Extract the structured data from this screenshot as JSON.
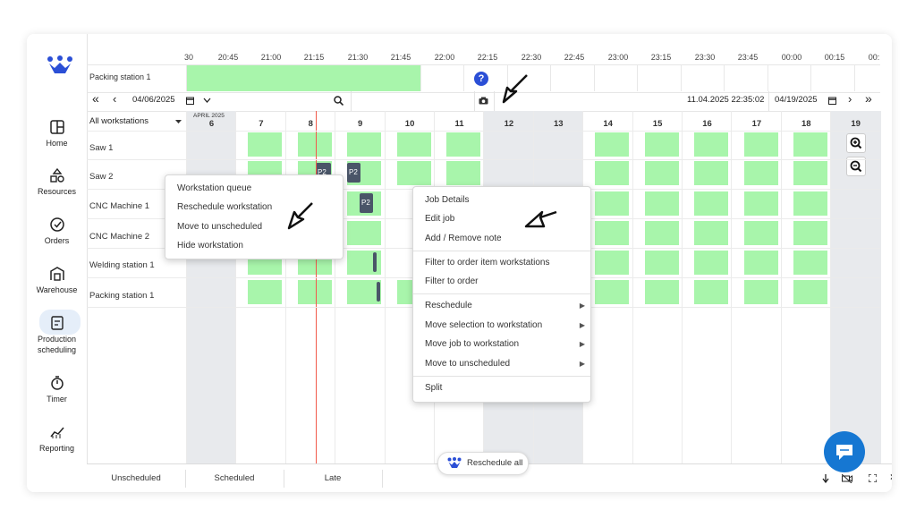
{
  "sidebar": {
    "items": [
      {
        "label": "Home",
        "icon": "home-icon"
      },
      {
        "label": "Resources",
        "icon": "resources-icon"
      },
      {
        "label": "Orders",
        "icon": "orders-icon"
      },
      {
        "label": "Warehouse",
        "icon": "warehouse-icon"
      },
      {
        "label": "Production",
        "label2": "scheduling",
        "icon": "production-scheduling-icon",
        "active": true
      },
      {
        "label": "Timer",
        "icon": "timer-icon"
      },
      {
        "label": "Reporting",
        "icon": "reporting-icon"
      }
    ]
  },
  "timescale": [
    "30",
    "20:45",
    "21:00",
    "21:15",
    "21:30",
    "21:45",
    "22:00",
    "22:15",
    "22:30",
    "22:45",
    "23:00",
    "23:15",
    "23:30",
    "23:45",
    "00:00",
    "00:15",
    "00:"
  ],
  "timeline": {
    "label": "Packing station 1",
    "help": "?"
  },
  "toolbar": {
    "first": "«",
    "prev": "‹",
    "start_date": "04/06/2025",
    "timestamp": "11.04.2025 22:35:02",
    "end_date": "04/19/2025",
    "next": "›",
    "last": "»"
  },
  "filter": {
    "value": "All workstations"
  },
  "month_label": "APRIL 2025",
  "days": [
    "6",
    "7",
    "8",
    "9",
    "10",
    "11",
    "12",
    "13",
    "14",
    "15",
    "16",
    "17",
    "18",
    "19"
  ],
  "workstations": [
    "Saw 1",
    "Saw 2",
    "CNC Machine 1",
    "CNC Machine 2",
    "Welding station 1",
    "Packing station 1"
  ],
  "jobs": {
    "saw2_a": "P2",
    "saw2_b": "P2",
    "cnc1": "P2"
  },
  "left_menu": [
    "Workstation queue",
    "Reschedule workstation",
    "Move to unscheduled",
    "Hide workstation"
  ],
  "right_menu": {
    "group1": [
      "Job Details",
      "Edit job",
      "Add / Remove note"
    ],
    "group2": [
      "Filter to order item workstations",
      "Filter to order"
    ],
    "group3": [
      "Reschedule",
      "Move selection to workstation",
      "Move job to workstation",
      "Move to unscheduled"
    ],
    "group4": [
      "Split"
    ]
  },
  "bottom_tabs": [
    "Unscheduled",
    "Scheduled",
    "Late"
  ],
  "reschedule_all": "Reschedule all",
  "colors": {
    "scheduled_block": "#a8f5ab",
    "now_line": "#f15a4a",
    "accent": "#2b4fd6",
    "job": "#4a5568"
  }
}
